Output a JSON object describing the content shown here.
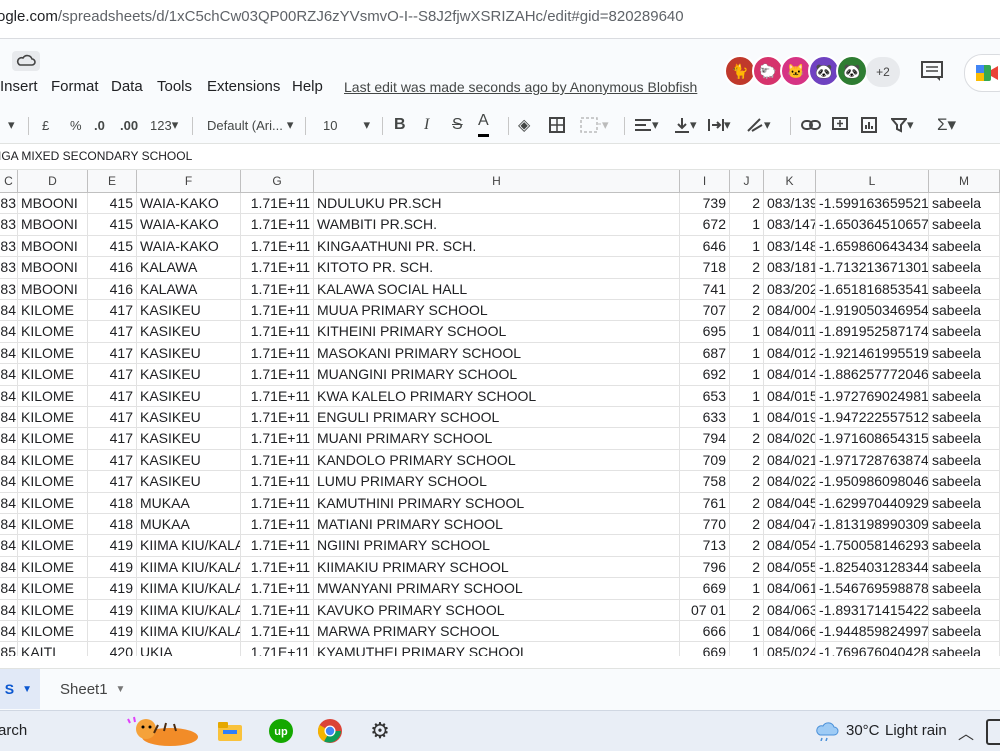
{
  "browser": {
    "url_host": "ogle.com",
    "url_path": "/spreadsheets/d/1xC5chCw03QP00RZJ6zYVsmvO-I--S8J2fjwXSRIZAHc/edit#gid=820289640"
  },
  "menu": {
    "items": [
      "Insert",
      "Format",
      "Data",
      "Tools",
      "Extensions",
      "Help"
    ],
    "last_edit": "Last edit was made seconds ago by Anonymous Blobfish"
  },
  "collaborators": {
    "extra_count": "+2",
    "colors": [
      "#c0392b",
      "#d6336c",
      "#d63384",
      "#6f42c1",
      "#2e7d32"
    ]
  },
  "toolbar": {
    "currency": "£",
    "percent": "%",
    "dec_decrease": ".0",
    "dec_increase": ".00",
    "number_format": "123",
    "font": "Default (Ari...",
    "font_size": "10",
    "bold": "B",
    "italic": "I",
    "strike": "S",
    "text_color": "A"
  },
  "formula_bar": {
    "content": "IGA MIXED SECONDARY SCHOOL"
  },
  "columns": [
    "C",
    "D",
    "E",
    "F",
    "G",
    "H",
    "I",
    "J",
    "K",
    "L",
    "M"
  ],
  "rows": [
    [
      "83",
      "MBOONI",
      "415",
      "WAIA-KAKO",
      "1.71E+11",
      "NDULUKU PR.SCH",
      "739",
      "2",
      "083/139",
      "-1.599163659521",
      "sabeela"
    ],
    [
      "83",
      "MBOONI",
      "415",
      "WAIA-KAKO",
      "1.71E+11",
      "WAMBITI PR.SCH.",
      "672",
      "1",
      "083/147",
      "-1.650364510657",
      "sabeela"
    ],
    [
      "83",
      "MBOONI",
      "415",
      "WAIA-KAKO",
      "1.71E+11",
      "KINGAATHUNI PR. SCH.",
      "646",
      "1",
      "083/148",
      "-1.659860643434",
      "sabeela"
    ],
    [
      "83",
      "MBOONI",
      "416",
      "KALAWA",
      "1.71E+11",
      "KITOTO PR. SCH.",
      "718",
      "2",
      "083/181",
      "-1.713213671301",
      "sabeela"
    ],
    [
      "83",
      "MBOONI",
      "416",
      "KALAWA",
      "1.71E+11",
      "KALAWA SOCIAL HALL",
      "741",
      "2",
      "083/202",
      "-1.651816853541",
      "sabeela"
    ],
    [
      "84",
      "KILOME",
      "417",
      "KASIKEU",
      "1.71E+11",
      "MUUA PRIMARY SCHOOL",
      "707",
      "2",
      "084/004",
      "-1.919050346954",
      "sabeela"
    ],
    [
      "84",
      "KILOME",
      "417",
      "KASIKEU",
      "1.71E+11",
      "KITHEINI PRIMARY SCHOOL",
      "695",
      "1",
      "084/011",
      "-1.891952587174",
      "sabeela"
    ],
    [
      "84",
      "KILOME",
      "417",
      "KASIKEU",
      "1.71E+11",
      "MASOKANI PRIMARY SCHOOL",
      "687",
      "1",
      "084/012",
      "-1.921461995519",
      "sabeela"
    ],
    [
      "84",
      "KILOME",
      "417",
      "KASIKEU",
      "1.71E+11",
      "MUANGINI PRIMARY SCHOOL",
      "692",
      "1",
      "084/014",
      "-1.886257772046",
      "sabeela"
    ],
    [
      "84",
      "KILOME",
      "417",
      "KASIKEU",
      "1.71E+11",
      "KWA KALELO PRIMARY SCHOOL",
      "653",
      "1",
      "084/015",
      "-1.972769024981",
      "sabeela"
    ],
    [
      "84",
      "KILOME",
      "417",
      "KASIKEU",
      "1.71E+11",
      "ENGULI PRIMARY SCHOOL",
      "633",
      "1",
      "084/019",
      "-1.947222557512",
      "sabeela"
    ],
    [
      "84",
      "KILOME",
      "417",
      "KASIKEU",
      "1.71E+11",
      "MUANI PRIMARY SCHOOL",
      "794",
      "2",
      "084/020",
      "-1.971608654315",
      "sabeela"
    ],
    [
      "84",
      "KILOME",
      "417",
      "KASIKEU",
      "1.71E+11",
      "KANDOLO PRIMARY SCHOOL",
      "709",
      "2",
      "084/021",
      "-1.971728763874",
      "sabeela"
    ],
    [
      "84",
      "KILOME",
      "417",
      "KASIKEU",
      "1.71E+11",
      "LUMU PRIMARY SCHOOL",
      "758",
      "2",
      "084/022",
      "-1.950986098046",
      "sabeela"
    ],
    [
      "84",
      "KILOME",
      "418",
      "MUKAA",
      "1.71E+11",
      "KAMUTHINI PRIMARY SCHOOL",
      "761",
      "2",
      "084/045",
      "-1.629970440929",
      "sabeela"
    ],
    [
      "84",
      "KILOME",
      "418",
      "MUKAA",
      "1.71E+11",
      "MATIANI PRIMARY SCHOOL",
      "770",
      "2",
      "084/047",
      "-1.813198990309",
      "sabeela"
    ],
    [
      "84",
      "KILOME",
      "419",
      "KIIMA KIU/KALA",
      "1.71E+11",
      "NGIINI PRIMARY SCHOOL",
      "713",
      "2",
      "084/054",
      "-1.750058146293",
      "sabeela"
    ],
    [
      "84",
      "KILOME",
      "419",
      "KIIMA KIU/KALA",
      "1.71E+11",
      "KIIMAKIU PRIMARY SCHOOL",
      "796",
      "2",
      "084/055",
      "-1.825403128344",
      "sabeela"
    ],
    [
      "84",
      "KILOME",
      "419",
      "KIIMA KIU/KALA",
      "1.71E+11",
      "MWANYANI PRIMARY SCHOOL",
      "669",
      "1",
      "084/061",
      "-1.546769598878",
      "sabeela"
    ],
    [
      "84",
      "KILOME",
      "419",
      "KIIMA KIU/KALA",
      "1.71E+11",
      "KAVUKO PRIMARY SCHOOL",
      "07 01",
      "2",
      "084/063",
      "-1.893171415422",
      "sabeela"
    ],
    [
      "84",
      "KILOME",
      "419",
      "KIIMA KIU/KALA",
      "1.71E+11",
      "MARWA PRIMARY SCHOOL",
      "666",
      "1",
      "084/066",
      "-1.944859824997",
      "sabeela"
    ],
    [
      "85",
      "KAITI",
      "420",
      "UKIA",
      "1.71E+11",
      "KYAMUTHEI PRIMARY SCHOOL",
      "669",
      "1",
      "085/024",
      "-1.769676040428",
      "sabeela"
    ]
  ],
  "sheets": {
    "active": "S",
    "other": "Sheet1"
  },
  "taskbar": {
    "search": "arch",
    "weather_temp": "30°C",
    "weather_desc": "Light rain"
  }
}
